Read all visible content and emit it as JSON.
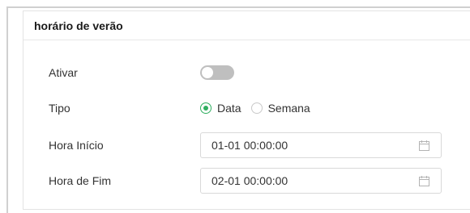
{
  "section": {
    "title": "horário de verão"
  },
  "fields": {
    "enable": {
      "label": "Ativar",
      "value": false
    },
    "type": {
      "label": "Tipo",
      "options": [
        "Data",
        "Semana"
      ],
      "selected": "Data"
    },
    "start_time": {
      "label": "Hora Início",
      "value": "01-01 00:00:00",
      "icon": "calendar-icon"
    },
    "end_time": {
      "label": "Hora de Fim",
      "value": "02-01 00:00:00",
      "icon": "calendar-icon"
    }
  },
  "colors": {
    "accent": "#2fae5f",
    "toggle_off": "#bfbfbf",
    "border": "#d9d9d9"
  }
}
